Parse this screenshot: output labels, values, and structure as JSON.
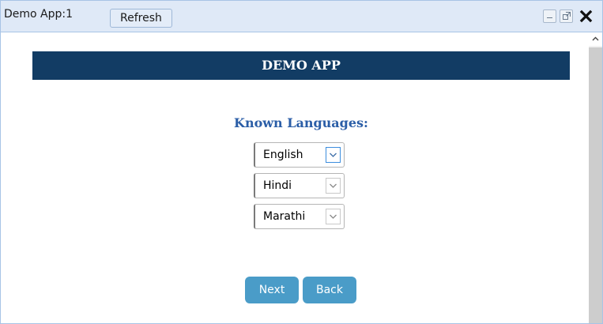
{
  "titlebar": {
    "title": "Demo App:1",
    "refresh_label": "Refresh"
  },
  "header": {
    "title": "DEMO APP"
  },
  "form": {
    "label": "Known Languages:",
    "selects": [
      {
        "value": "English"
      },
      {
        "value": "Hindi"
      },
      {
        "value": "Marathi"
      }
    ]
  },
  "actions": {
    "next_label": "Next",
    "back_label": "Back"
  },
  "icons": {
    "minimize": "minimize-icon",
    "popout": "popout-icon",
    "close": "close-icon",
    "dropdown": "chevron-down-icon",
    "scroll_up": "chevron-up-icon"
  },
  "colors": {
    "header_bg": "#123c64",
    "label_color": "#2b5ea7",
    "button_bg": "#4a9cc8",
    "titlebar_bg": "#dfe9f7"
  }
}
